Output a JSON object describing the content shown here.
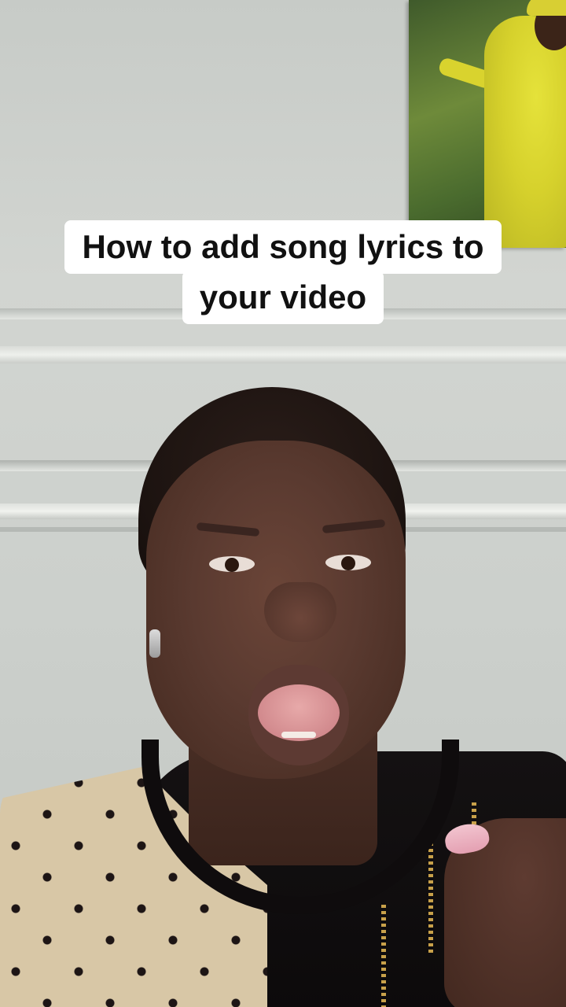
{
  "caption": {
    "line1": "How to add song lyrics to",
    "line2": "your video"
  },
  "colors": {
    "caption_background": "#ffffff",
    "caption_text": "#111111",
    "wall": "#cfd2ce"
  }
}
